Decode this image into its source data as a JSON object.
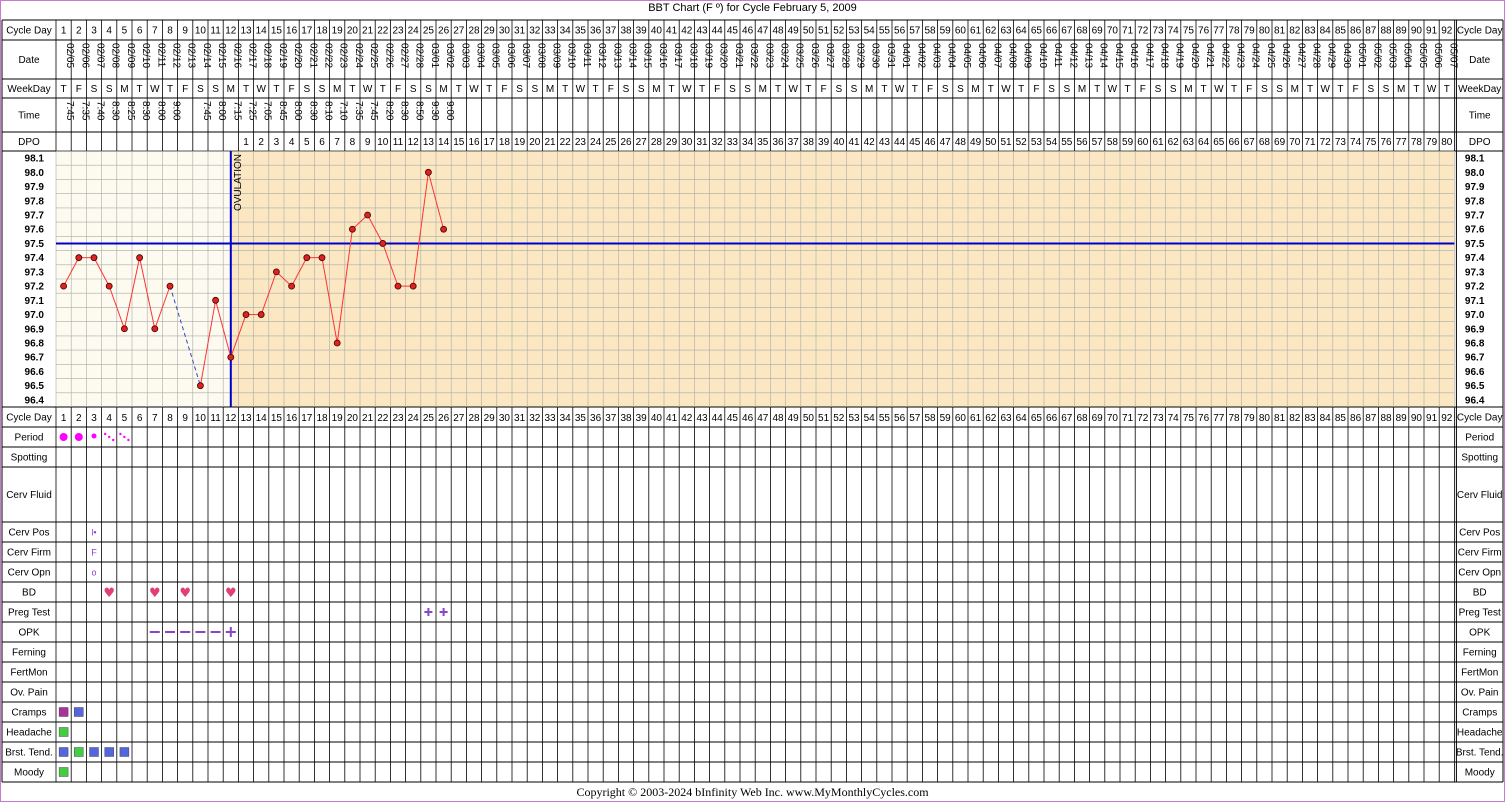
{
  "title": "BBT Chart (F º) for Cycle February 5, 2009",
  "copyright": "Copyright © 2003-2024 bInfinity Web Inc.     www.MyMonthlyCycles.com",
  "row_labels": {
    "cycle_day": "Cycle Day",
    "date": "Date",
    "weekday": "WeekDay",
    "time": "Time",
    "dpo": "DPO",
    "period": "Period",
    "spotting": "Spotting",
    "cerv_fluid": "Cerv Fluid",
    "cerv_pos": "Cerv Pos",
    "cerv_firm": "Cerv Firm",
    "cerv_opn": "Cerv Opn",
    "bd": "BD",
    "preg_test": "Preg Test",
    "opk": "OPK",
    "ferning": "Ferning",
    "fertmon": "FertMon",
    "ov_pain": "Ov. Pain",
    "cramps": "Cramps",
    "headache": "Headache",
    "brst_tend": "Brst. Tend.",
    "moody": "Moody"
  },
  "ovulation_label": "OVULATION",
  "colors": {
    "frame": "#cc77cc",
    "grid": "#aaaaaa",
    "pre_ov_bg": "#fdfbef",
    "post_ov_bg": "#fbe8c2",
    "coverline": "#0000cc",
    "temp_line": "#ff3333",
    "temp_point": "#dd2222",
    "period": "#ff00ff",
    "bd_heart": "#e0407a",
    "preg_test": "#8844cc",
    "opk": "#8844cc",
    "cramps_1": "#aa3399",
    "symptom_blue": "#5566dd",
    "symptom_green": "#44cc44"
  },
  "chart_data": {
    "type": "line",
    "title": "BBT Chart (F º) for Cycle February 5, 2009",
    "x_label": "Cycle Day",
    "y_label": "",
    "ylim": [
      96.4,
      98.1
    ],
    "y_ticks": [
      "98.1",
      "98.0",
      "97.9",
      "97.8",
      "97.7",
      "97.6",
      "97.5",
      "97.4",
      "97.3",
      "97.2",
      "97.1",
      "97.0",
      "96.9",
      "96.8",
      "96.7",
      "96.6",
      "96.5",
      "96.4"
    ],
    "cycle_days": [
      1,
      2,
      3,
      4,
      5,
      6,
      7,
      8,
      9,
      10,
      11,
      12,
      13,
      14,
      15,
      16,
      17,
      18,
      19,
      20,
      21,
      22,
      23,
      24,
      25,
      26,
      27,
      28,
      29,
      30,
      31,
      32,
      33,
      34,
      35,
      36,
      37,
      38,
      39,
      40,
      41,
      42,
      43,
      44,
      45,
      46,
      47,
      48,
      49,
      50,
      51,
      52,
      53,
      54,
      55,
      56,
      57,
      58,
      59,
      60,
      61,
      62,
      63,
      64,
      65,
      66,
      67,
      68,
      69,
      70,
      71,
      72,
      73,
      74,
      75,
      76,
      77,
      78,
      79,
      80,
      81,
      82,
      83,
      84,
      85,
      86,
      87,
      88,
      89,
      90,
      91,
      92
    ],
    "dates": [
      "02/05",
      "02/06",
      "02/07",
      "02/08",
      "02/09",
      "02/10",
      "02/11",
      "02/12",
      "02/13",
      "02/14",
      "02/15",
      "02/16",
      "02/17",
      "02/18",
      "02/19",
      "02/20",
      "02/21",
      "02/22",
      "02/23",
      "02/24",
      "02/25",
      "02/26",
      "02/27",
      "02/28",
      "03/01",
      "03/02",
      "03/03",
      "03/04",
      "03/05",
      "03/06",
      "03/07",
      "03/08",
      "03/09",
      "03/10",
      "03/11",
      "03/12",
      "03/13",
      "03/14",
      "03/15",
      "03/16",
      "03/17",
      "03/18",
      "03/19",
      "03/20",
      "03/21",
      "03/22",
      "03/23",
      "03/24",
      "03/25",
      "03/26",
      "03/27",
      "03/28",
      "03/29",
      "03/30",
      "03/31",
      "04/01",
      "04/02",
      "04/03",
      "04/04",
      "04/05",
      "04/06",
      "04/07",
      "04/08",
      "04/09",
      "04/10",
      "04/11",
      "04/12",
      "04/13",
      "04/14",
      "04/15",
      "04/16",
      "04/17",
      "04/18",
      "04/19",
      "04/20",
      "04/21",
      "04/22",
      "04/23",
      "04/24",
      "04/25",
      "04/26",
      "04/27",
      "04/28",
      "04/29",
      "04/30",
      "05/01",
      "05/02",
      "05/03",
      "05/04",
      "05/05",
      "05/06",
      "05/07"
    ],
    "weekdays": [
      "T",
      "F",
      "S",
      "S",
      "M",
      "T",
      "W",
      "T",
      "F",
      "S",
      "S",
      "M",
      "T",
      "W",
      "T",
      "F",
      "S",
      "S",
      "M",
      "T",
      "W",
      "T",
      "F",
      "S",
      "S",
      "M",
      "T",
      "W",
      "T",
      "F",
      "S",
      "S",
      "M",
      "T",
      "W",
      "T",
      "F",
      "S",
      "S",
      "M",
      "T",
      "W",
      "T",
      "F",
      "S",
      "S",
      "M",
      "T",
      "W",
      "T",
      "F",
      "S",
      "S",
      "M",
      "T",
      "W",
      "T",
      "F",
      "S",
      "S",
      "M",
      "T",
      "W",
      "T",
      "F",
      "S",
      "S",
      "M",
      "T",
      "W",
      "T",
      "F",
      "S",
      "S",
      "M",
      "T",
      "W",
      "T",
      "F",
      "S",
      "S",
      "M",
      "T",
      "W",
      "T",
      "F",
      "S",
      "S",
      "M",
      "T",
      "W",
      "T"
    ],
    "times": [
      "7:45",
      "7:35",
      "7:40",
      "8:30",
      "8:25",
      "8:30",
      "8:00",
      "9:00",
      "",
      "7:45",
      "8:00",
      "7:15",
      "7:25",
      "7:05",
      "8:45",
      "8:00",
      "8:30",
      "8:10",
      "7:10",
      "7:35",
      "7:45",
      "8:20",
      "8:30",
      "8:50",
      "9:30",
      "9:00"
    ],
    "dpo_start_day": 13,
    "dpo": [
      1,
      2,
      3,
      4,
      5,
      6,
      7,
      8,
      9,
      10,
      11,
      12,
      13,
      14,
      15,
      16,
      17,
      18,
      19,
      20,
      21,
      22,
      23,
      24,
      25,
      26,
      27,
      28,
      29,
      30,
      31,
      32,
      33,
      34,
      35,
      36,
      37,
      38,
      39,
      40,
      41,
      42,
      43,
      44,
      45,
      46,
      47,
      48,
      49,
      50,
      51,
      52,
      53,
      54,
      55,
      56,
      57,
      58,
      59,
      60,
      61,
      62,
      63,
      64,
      65,
      66,
      67,
      68,
      69,
      70,
      71,
      72,
      73,
      74,
      75,
      76,
      77,
      78,
      79,
      80
    ],
    "ovulation_day": 12,
    "coverline": 97.5,
    "temperatures": [
      97.2,
      97.4,
      97.4,
      97.2,
      96.9,
      97.4,
      96.9,
      97.2,
      null,
      96.5,
      97.1,
      96.7,
      97.0,
      97.0,
      97.3,
      97.2,
      97.4,
      97.4,
      96.8,
      97.6,
      97.7,
      97.5,
      97.2,
      97.2,
      98.0,
      97.6
    ],
    "dashed_segments": [
      [
        8,
        10
      ]
    ],
    "period": [
      {
        "day": 1,
        "type": "heavy"
      },
      {
        "day": 2,
        "type": "heavy"
      },
      {
        "day": 3,
        "type": "medium"
      },
      {
        "day": 4,
        "type": "light"
      },
      {
        "day": 5,
        "type": "light"
      }
    ],
    "cerv_pos": [
      {
        "day": 3,
        "value": "l•"
      }
    ],
    "cerv_firm": [
      {
        "day": 3,
        "value": "F"
      }
    ],
    "cerv_opn": [
      {
        "day": 3,
        "value": "o"
      }
    ],
    "bd": [
      4,
      7,
      9,
      12
    ],
    "preg_test": [
      25,
      26
    ],
    "opk_negative": [
      7,
      8,
      9,
      10,
      11
    ],
    "opk_positive": [
      12
    ],
    "cramps": [
      {
        "day": 1,
        "color": "#aa3399"
      },
      {
        "day": 2,
        "color": "#5566dd"
      }
    ],
    "headache": [
      {
        "day": 1,
        "color": "#44cc44"
      }
    ],
    "brst_tend": [
      {
        "day": 1,
        "color": "#5566dd"
      },
      {
        "day": 2,
        "color": "#44cc44"
      },
      {
        "day": 3,
        "color": "#5566dd"
      },
      {
        "day": 4,
        "color": "#5566dd"
      },
      {
        "day": 5,
        "color": "#5566dd"
      }
    ],
    "moody": [
      {
        "day": 1,
        "color": "#44cc44"
      }
    ]
  }
}
